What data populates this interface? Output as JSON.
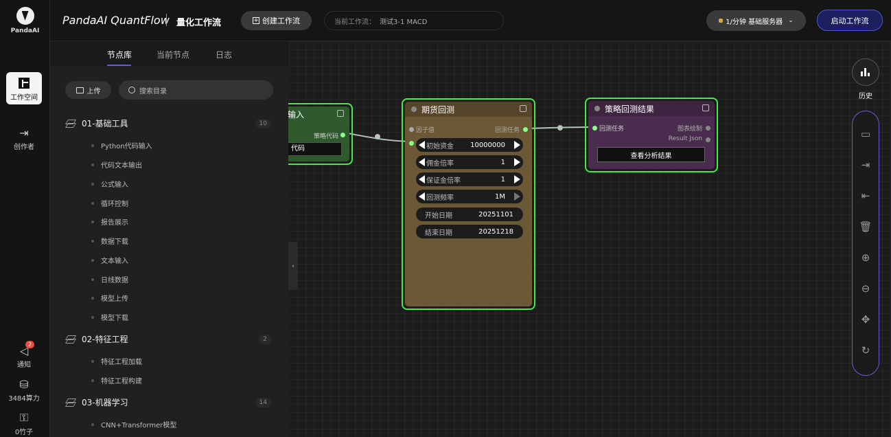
{
  "rail": {
    "logo_text": "PandaAI",
    "items": [
      {
        "label": "工作空间",
        "icon": "workspace-icon"
      },
      {
        "label": "创作者",
        "icon": "export-icon"
      }
    ],
    "bottom": [
      {
        "label": "通知",
        "badge": "2",
        "icon": "megaphone-icon"
      },
      {
        "label": "3484算力",
        "icon": "database-icon"
      },
      {
        "label": "0竹子",
        "icon": "bamboo-icon"
      }
    ]
  },
  "topbar": {
    "brand": "PandaAI QuantFlow",
    "subtitle": "量化工作流",
    "create_label": "创建工作流",
    "current_flow_label": "当前工作流：",
    "current_flow_value": "测试3-1 MACD",
    "server_label": "1/分钟  基础服务器",
    "start_label": "启动工作流"
  },
  "panel": {
    "tabs": [
      "节点库",
      "当前节点",
      "日志"
    ],
    "upload_label": "上传",
    "search_placeholder": "搜索目录",
    "groups": [
      {
        "name": "01-基础工具",
        "count": "10",
        "items": [
          "Python代码输入",
          "代码文本输出",
          "公式输入",
          "循环控制",
          "报告展示",
          "数据下载",
          "文本输入",
          "日线数据",
          "模型上传",
          "模型下载"
        ]
      },
      {
        "name": "02-特征工程",
        "count": "2",
        "items": [
          "特征工程加载",
          "特征工程构建"
        ]
      },
      {
        "name": "03-机器学习",
        "count": "14",
        "items": [
          "CNN+Transformer模型"
        ]
      }
    ]
  },
  "nodes": {
    "code_input": {
      "title_fragment": "输入",
      "port_out": "策略代码",
      "field": "代码"
    },
    "futures_backtest": {
      "title": "期货回测",
      "in_port": "因子值",
      "out_port": "回测任务",
      "fields": [
        {
          "label": "初始资金",
          "value": "10000000"
        },
        {
          "label": "佣金倍率",
          "value": "1"
        },
        {
          "label": "保证金倍率",
          "value": "1"
        },
        {
          "label": "回测频率",
          "value": "1M"
        },
        {
          "label": "开始日期",
          "value": "20251101"
        },
        {
          "label": "结束日期",
          "value": "20251218"
        }
      ]
    },
    "result": {
      "title": "策略回测结果",
      "in_port": "回测任务",
      "out_ports": [
        "图表绘制",
        "Result Json"
      ],
      "button": "查看分析结果"
    }
  },
  "right_tools": {
    "history_label": "历史",
    "tools": [
      "save-icon",
      "export-icon",
      "import-icon",
      "delete-icon",
      "zoom-in-icon",
      "zoom-out-icon",
      "move-icon",
      "refresh-icon"
    ]
  },
  "colors": {
    "accent": "#5b5be6",
    "node_border": "#4ae84a",
    "backtest_body": "#6b5836",
    "result_body": "#4a2d4e",
    "code_body": "#2e5a2e"
  }
}
